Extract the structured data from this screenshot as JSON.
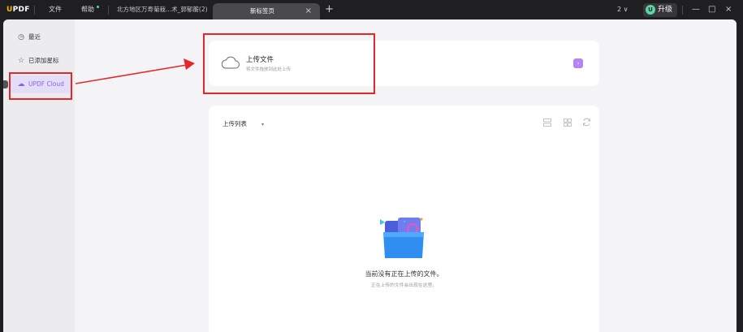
{
  "titlebar": {
    "logo_u": "U",
    "logo_rest": "PDF",
    "menu_file": "文件",
    "menu_help": "帮助",
    "tab_inactive": "北方地区万寿菊栽...术_郭郁蘅(2)",
    "tab_active": "新标签页",
    "tab_close": "×",
    "new_tab": "+",
    "version": "2 ∨",
    "upgrade_badge": "U",
    "upgrade_label": "升级",
    "minimize": "—",
    "maximize": "□",
    "close": "×"
  },
  "sidebar": {
    "items": [
      {
        "label": "最近",
        "icon": "clock-icon",
        "glyph": "◷"
      },
      {
        "label": "已添加星标",
        "icon": "star-icon",
        "glyph": "☆"
      },
      {
        "label": "UPDF Cloud",
        "icon": "cloud-icon",
        "glyph": "☁"
      }
    ],
    "active_index": 2
  },
  "upload": {
    "title": "上传文件",
    "subtitle": "将文件拖放到此处上传",
    "go": "›"
  },
  "list": {
    "header": "上传列表",
    "caret": "▾",
    "empty_title": "当前没有正在上传的文件。",
    "empty_subtitle": "正在上传的文件会出现在这里。"
  },
  "colors": {
    "accent": "#8a61e8",
    "annotation": "#e8262a",
    "logo_u": "#f7b500"
  }
}
